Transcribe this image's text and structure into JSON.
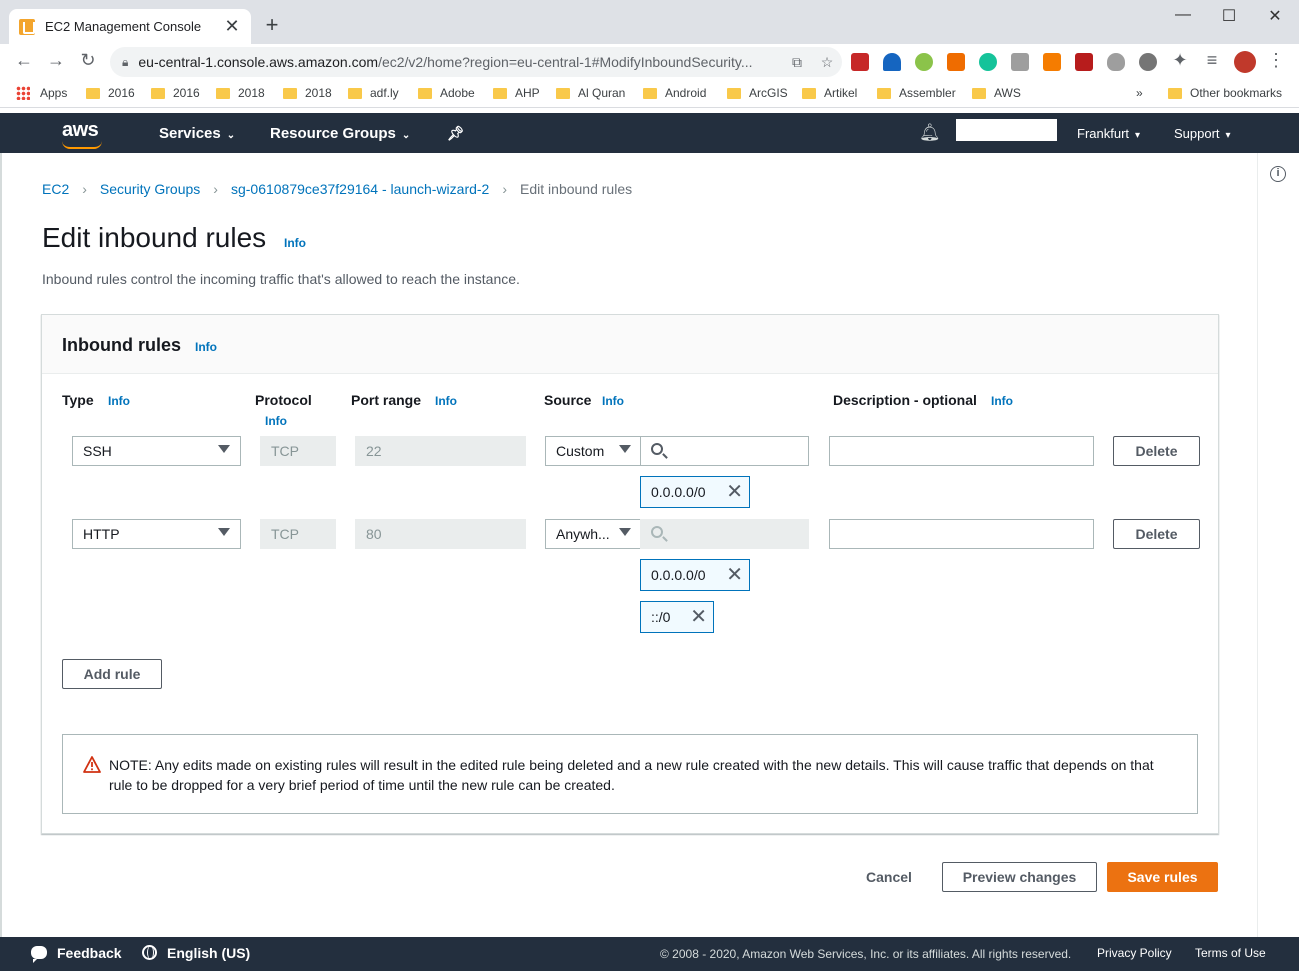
{
  "browser": {
    "tab_title": "EC2 Management Console",
    "url_host": "eu-central-1.console.aws.amazon.com",
    "url_path": "/ec2/v2/home?region=eu-central-1#ModifyInboundSecurity...",
    "bookmarks": [
      "Apps",
      "2016",
      "2016",
      "2018",
      "2018",
      "adf.ly",
      "Adobe",
      "AHP",
      "Al Quran",
      "Android",
      "ArcGIS",
      "Artikel",
      "Assembler",
      "AWS"
    ],
    "bookmarks_more": "»",
    "other_bookmarks": "Other bookmarks"
  },
  "aws_header": {
    "logo": "aws",
    "services": "Services",
    "resource_groups": "Resource Groups",
    "region": "Frankfurt",
    "support": "Support"
  },
  "breadcrumb": {
    "items": [
      "EC2",
      "Security Groups",
      "sg-0610879ce37f29164 - launch-wizard-2"
    ],
    "current": "Edit inbound rules"
  },
  "page": {
    "title": "Edit inbound rules",
    "info": "Info",
    "description": "Inbound rules control the incoming traffic that's allowed to reach the instance."
  },
  "panel": {
    "title": "Inbound rules",
    "info": "Info",
    "columns": {
      "type": "Type",
      "protocol": "Protocol",
      "port_range": "Port range",
      "source": "Source",
      "description": "Description - optional"
    },
    "rules": [
      {
        "type": "SSH",
        "protocol": "TCP",
        "port": "22",
        "source_mode": "Custom",
        "tokens": [
          "0.0.0.0/0"
        ],
        "description": "",
        "delete": "Delete"
      },
      {
        "type": "HTTP",
        "protocol": "TCP",
        "port": "80",
        "source_mode": "Anywh...",
        "tokens": [
          "0.0.0.0/0",
          "::/0"
        ],
        "description": "",
        "delete": "Delete"
      }
    ],
    "add_rule": "Add rule",
    "note": "NOTE: Any edits made on existing rules will result in the edited rule being deleted and a new rule created with the new details. This will cause traffic that depends on that rule to be dropped for a very brief period of time until the new rule can be created."
  },
  "actions": {
    "cancel": "Cancel",
    "preview": "Preview changes",
    "save": "Save rules"
  },
  "footer": {
    "feedback": "Feedback",
    "language": "English (US)",
    "copyright": "© 2008 - 2020, Amazon Web Services, Inc. or its affiliates. All rights reserved.",
    "privacy": "Privacy Policy",
    "terms": "Terms of Use"
  },
  "colors": {
    "aws_dark": "#232f3e",
    "link": "#0073bb",
    "primary": "#ec7211",
    "warning": "#d13212"
  }
}
